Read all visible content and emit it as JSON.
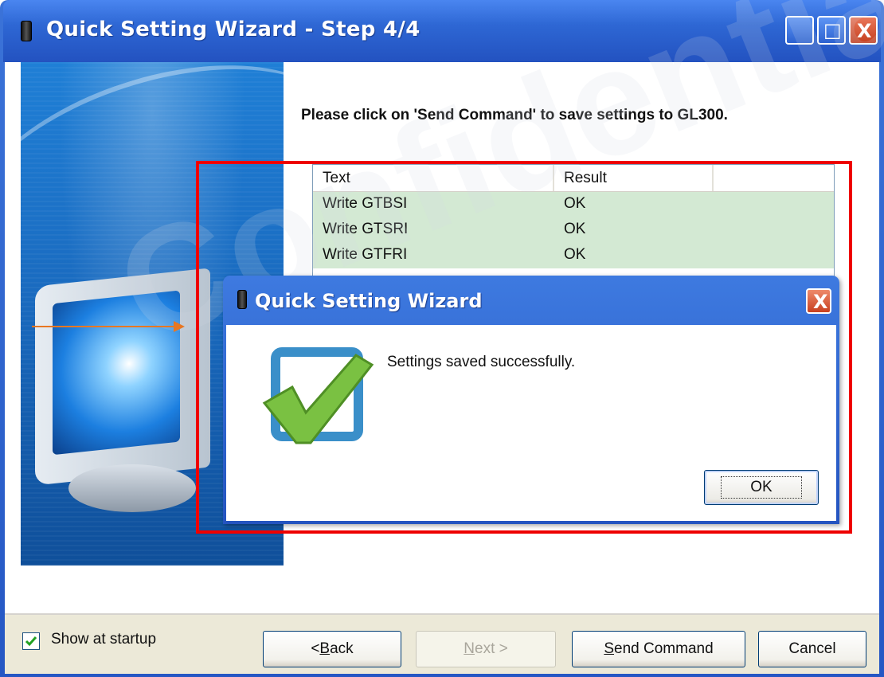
{
  "window": {
    "title": "Quick Setting Wizard - Step 4/4",
    "controls": {
      "minimize": "_",
      "maximize": "□",
      "close": "X"
    }
  },
  "instruction": "Please click on 'Send Command' to save settings to GL300.",
  "list": {
    "columns": [
      "Text",
      "Result",
      ""
    ],
    "rows": [
      {
        "text": "Write GTBSI",
        "result": "OK"
      },
      {
        "text": "Write GTSRI",
        "result": "OK"
      },
      {
        "text": "Write GTFRI",
        "result": "OK"
      }
    ]
  },
  "dialog": {
    "title": "Quick Setting Wizard",
    "close": "X",
    "message": "Settings saved successfully.",
    "ok_label": "OK",
    "icon": "success-checkmark-icon"
  },
  "footer": {
    "show_at_startup": {
      "label": "Show at startup",
      "checked": true
    },
    "back_prefix": "< ",
    "back_key": "B",
    "back_rest": "ack",
    "next_key": "N",
    "next_rest": "ext >",
    "send_key": "S",
    "send_rest": "end Command",
    "cancel": "Cancel"
  },
  "watermark": "Confidential",
  "colors": {
    "titlebar": "#2e67d4",
    "annotation_frame": "#ee0000",
    "annotation_arrow": "#e87722",
    "list_row_bg": "#d3e9d3"
  }
}
